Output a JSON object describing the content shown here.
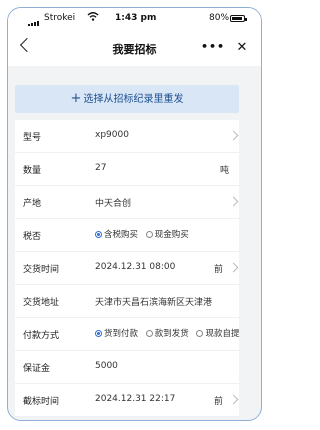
{
  "status_bar": {
    "carrier": "Strokei",
    "time": "1:43 pm",
    "battery": "80%"
  },
  "nav": {
    "title": "我要招标",
    "more": "•••",
    "close": "✕"
  },
  "reselect": {
    "icon": "+",
    "label": "选择从招标纪录里重发"
  },
  "form": {
    "model": {
      "label": "型号",
      "value": "xp9000"
    },
    "quantity": {
      "label": "数量",
      "value": "27",
      "unit": "吨"
    },
    "origin": {
      "label": "产地",
      "value": "中天合创"
    },
    "tax": {
      "label": "税否",
      "options": [
        "含税购买",
        "现金购买"
      ],
      "selected": 0
    },
    "delivery_time": {
      "label": "交货时间",
      "value": "2024.12.31  08:00",
      "suffix": "前"
    },
    "delivery_address": {
      "label": "交货地址",
      "value": "天津市天昌石滨海新区天津港"
    },
    "payment": {
      "label": "付款方式",
      "options": [
        "货到付款",
        "款到发货",
        "现款自提"
      ],
      "selected": 0
    },
    "deposit": {
      "label": "保证金",
      "value": "5000"
    },
    "deadline": {
      "label": "截标时间",
      "value": "2024.12.31  22:17",
      "suffix": "前"
    }
  },
  "colors": {
    "accent": "#2f6fc7",
    "banner_bg": "#d8e6f6",
    "page_bg": "#f2f3f5",
    "frame": "#8fb0d6"
  }
}
